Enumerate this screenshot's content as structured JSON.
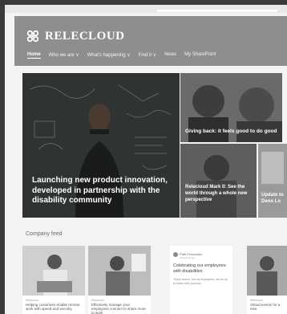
{
  "app": {
    "brand": "RELECLOUD"
  },
  "nav": {
    "items": [
      {
        "label": "Home",
        "active": true
      },
      {
        "label": "Who we are ∨"
      },
      {
        "label": "What's happening ∨"
      },
      {
        "label": "Find it ∨"
      },
      {
        "label": "News"
      },
      {
        "label": "My SharePoint"
      }
    ]
  },
  "hero": {
    "title": "Launching new product innovation, developed in partnership with the disability community"
  },
  "tiles": {
    "giving_back": "Giving back: it feels good to do good",
    "mark_ii": "Relecloud Mark II: See the world through a whole new perspective",
    "update": "Update to Deno Lo"
  },
  "feed": {
    "title": "Company feed",
    "cards": [
      {
        "site": "Relecloud",
        "title": "Helping customers enable remote work with speed and security"
      },
      {
        "site": "Relecloud",
        "title": "Effectively manage your employees connect to share more to work"
      },
      {
        "author": "Patti Fernandez",
        "subtitle": "Posted 5h ago",
        "title": "Celebrating our employees with disabilities",
        "body": "These stories, told by employees, are for all to follow their journeys"
      },
      {
        "site": "Relecloud",
        "title": "Virtual events for a new"
      }
    ]
  },
  "colors": {
    "header_bg": "#8e8e8e",
    "hero_bg": "#2b2f2d",
    "brand_text": "#ffffff"
  }
}
